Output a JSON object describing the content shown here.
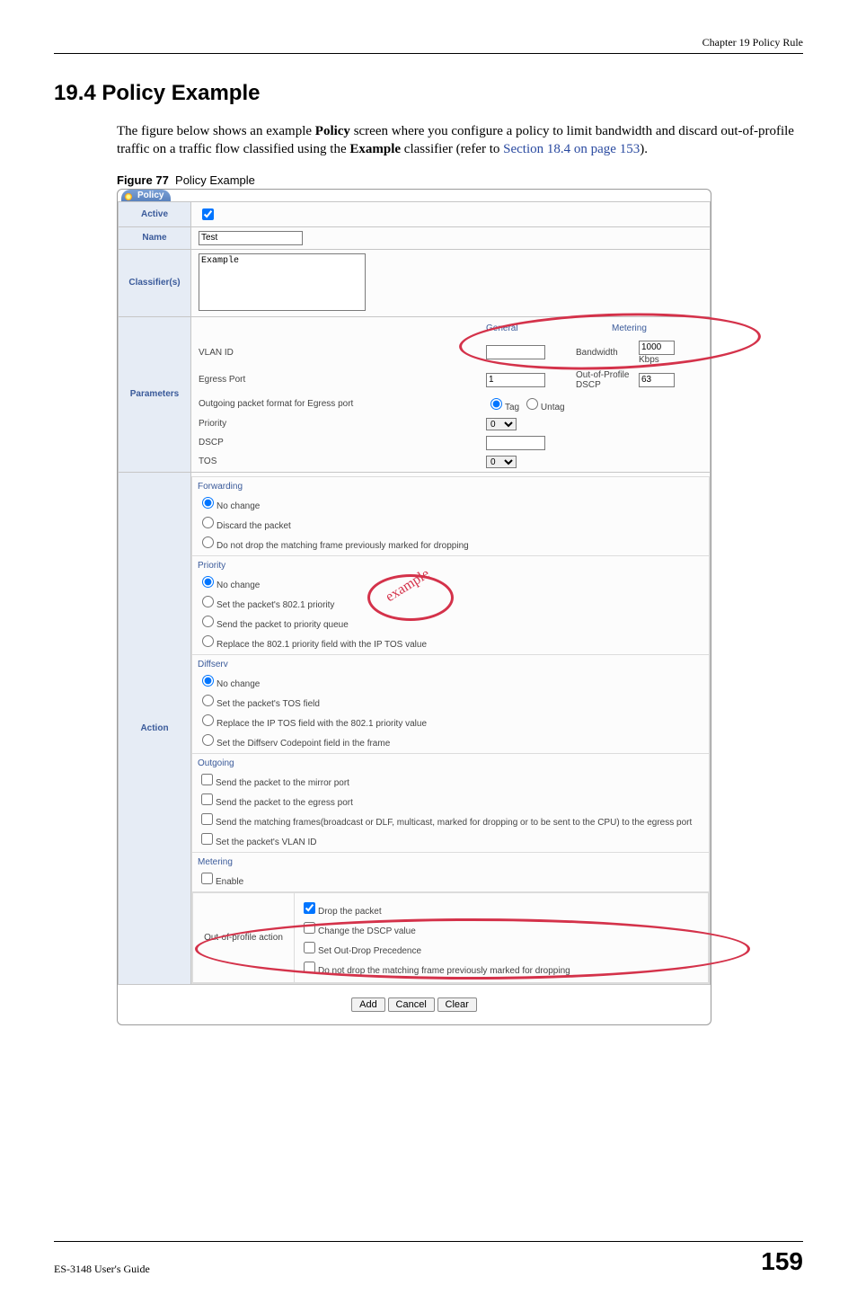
{
  "header": {
    "chapter": "Chapter 19 Policy Rule"
  },
  "section": {
    "title": "19.4  Policy Example",
    "para_before_b1": "The figure below shows an example ",
    "bold1": "Policy",
    "para_mid1": " screen where you configure a policy to limit bandwidth and discard out-of-profile traffic on a traffic flow classified using the ",
    "bold2": "Example",
    "para_mid2": " classifier (refer to ",
    "link": "Section 18.4 on page 153",
    "para_end": ")."
  },
  "figure": {
    "label": "Figure 77",
    "title": "Policy Example"
  },
  "tab": "Policy",
  "labels": {
    "active": "Active",
    "name": "Name",
    "classifiers": "Classifier(s)",
    "parameters": "Parameters",
    "action": "Action"
  },
  "fields": {
    "name_value": "Test",
    "classifier_value": "Example",
    "general_h": "General",
    "metering_h": "Metering",
    "vlan_id": "VLAN ID",
    "egress_port": "Egress Port",
    "egress_port_val": "1",
    "pkt_format": "Outgoing packet format for Egress port",
    "tag": "Tag",
    "untag": "Untag",
    "priority": "Priority",
    "priority_sel": "0",
    "dscp": "DSCP",
    "tos": "TOS",
    "tos_sel": "0",
    "bandwidth": "Bandwidth",
    "bandwidth_val": "1000",
    "kbps": "Kbps",
    "oop_dscp": "Out-of-Profile DSCP",
    "oop_dscp_val": "63"
  },
  "action": {
    "forwarding": "Forwarding",
    "fwd_opts": [
      "No change",
      "Discard the packet",
      "Do not drop the matching frame previously marked for dropping"
    ],
    "priority": "Priority",
    "pri_opts": [
      "No change",
      "Set the packet's 802.1 priority",
      "Send the packet to priority queue",
      "Replace the 802.1 priority field with the IP TOS value"
    ],
    "diffserv": "Diffserv",
    "ds_opts": [
      "No change",
      "Set the packet's TOS field",
      "Replace the IP TOS field with the 802.1 priority value",
      "Set the Diffserv Codepoint field in the frame"
    ],
    "outgoing": "Outgoing",
    "out_opts": [
      "Send the packet to the mirror port",
      "Send the packet to the egress port",
      "Send the matching frames(broadcast or DLF, multicast, marked for dropping or to be sent to the CPU) to the egress port",
      "Set the packet's VLAN ID"
    ],
    "metering": "Metering",
    "met_enable": "Enable",
    "oop_label": "Out-of-profile action",
    "oop_opts": [
      "Drop the packet",
      "Change the DSCP value",
      "Set Out-Drop Precedence",
      "Do not drop the matching frame previously marked for dropping"
    ]
  },
  "stamp": "example",
  "buttons": {
    "add": "Add",
    "cancel": "Cancel",
    "clear": "Clear"
  },
  "footer": {
    "guide": "ES-3148 User's Guide",
    "page": "159"
  }
}
